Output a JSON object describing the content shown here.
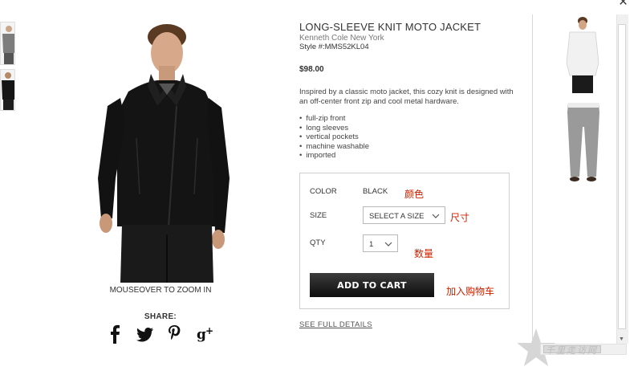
{
  "product": {
    "title": "LONG-SLEEVE KNIT MOTO JACKET",
    "brand": "Kenneth Cole New York",
    "style": "Style #:MMS52KL04",
    "price": "$98.00",
    "description": "Inspired by a classic moto jacket, this cozy knit is designed with an off-center front zip and cool metal hardware.",
    "features": [
      "full-zip front",
      "long sleeves",
      "vertical pockets",
      "machine washable",
      "imported"
    ]
  },
  "image": {
    "zoom_text": "MOUSEOVER TO ZOOM IN"
  },
  "share": {
    "label": "SHARE:"
  },
  "options": {
    "color_label": "COLOR",
    "color_value": "BLACK",
    "size_label": "SIZE",
    "size_value": "SELECT A SIZE",
    "qty_label": "QTY",
    "qty_value": "1",
    "add_to_cart": "ADD TO CART",
    "see_full_details": "SEE FULL DETAILS"
  },
  "annotations": {
    "color": "颜色",
    "size": "尺寸",
    "qty": "数量",
    "cart": "加入购物车"
  },
  "watermark": {
    "text": "千里走访网"
  },
  "colors": {
    "accent_annotation": "#cc2200",
    "button_dark": "#111111"
  },
  "icons": [
    "facebook-icon",
    "twitter-icon",
    "pinterest-icon",
    "google-plus-icon",
    "close-icon",
    "chevron-down-icon"
  ]
}
